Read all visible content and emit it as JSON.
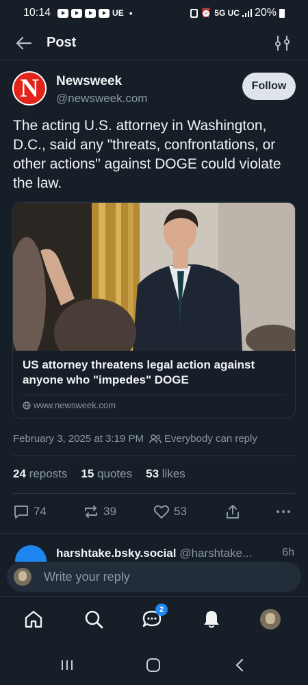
{
  "status_bar": {
    "time": "10:14",
    "carrier_tag": "UE",
    "network": "5G UC",
    "battery": "20%"
  },
  "header": {
    "title": "Post"
  },
  "post": {
    "author": {
      "name": "Newsweek",
      "handle": "@newsweek.com",
      "avatar_letter": "N",
      "brand_color": "#e2231a"
    },
    "follow_label": "Follow",
    "text": "The acting U.S. attorney in Washington, D.C., said any \"threats, confrontations, or other actions\" against DOGE could violate the law.",
    "link_card": {
      "title": "US attorney threatens legal action against anyone who \"impedes\" DOGE",
      "domain": "www.newsweek.com"
    },
    "timestamp": "February 3, 2025 at 3:19 PM",
    "reply_setting": "Everybody can reply",
    "stats": {
      "reposts_count": "24",
      "reposts_label": "reposts",
      "quotes_count": "15",
      "quotes_label": "quotes",
      "likes_count": "53",
      "likes_label": "likes"
    },
    "actions": {
      "replies": "74",
      "reposts": "39",
      "likes": "53"
    }
  },
  "reply_preview": {
    "name": "harshtake.bsky.social",
    "handle": "@harshtake...",
    "time": "6h"
  },
  "composer": {
    "placeholder": "Write your reply"
  },
  "bottom_nav": {
    "chat_badge": "2",
    "items": [
      "home-icon",
      "search-icon",
      "chat-icon",
      "notifications-icon",
      "profile-avatar"
    ]
  },
  "colors": {
    "background": "#161e27",
    "accent": "#1d86f0",
    "muted_text": "#8b98a8"
  }
}
